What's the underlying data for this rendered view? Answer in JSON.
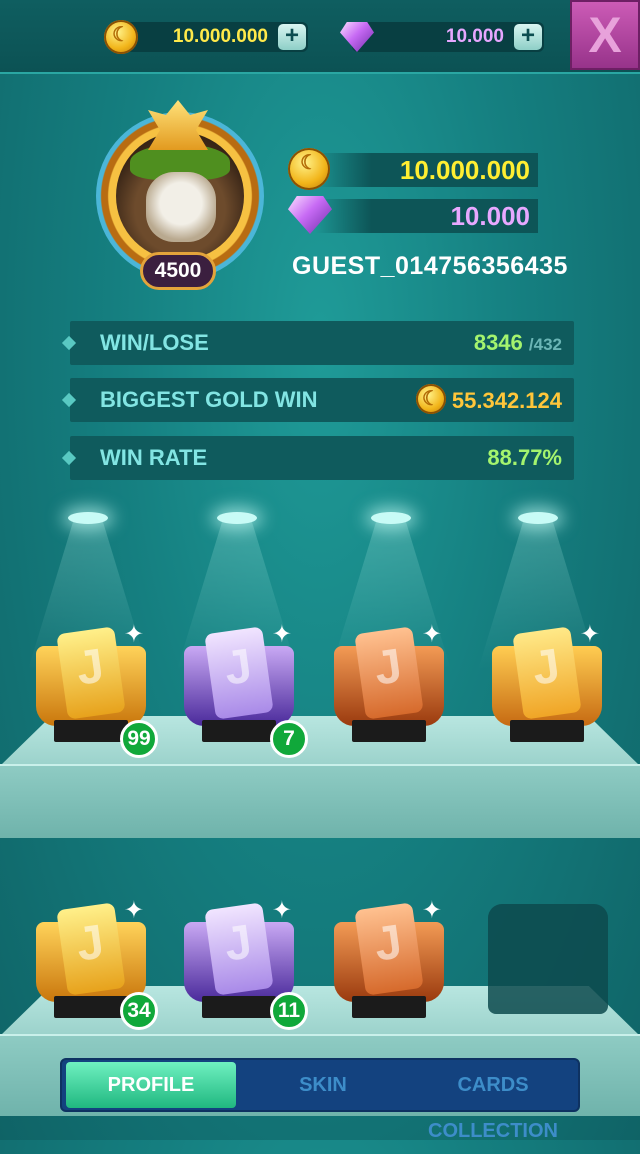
{
  "topbar": {
    "coin_icon": "gold-coin-icon",
    "coin_amount": "10.000.000",
    "gem_icon": "purple-gem-icon",
    "gem_amount": "10.000",
    "plus_label": "+",
    "close_label": "X"
  },
  "profile": {
    "level": "4500",
    "gold": "10.000.000",
    "gems": "10.000",
    "username": "GUEST_014756356435"
  },
  "stats": {
    "win_lose_label": "WIN/LOSE",
    "wins": "8346",
    "losses": "/432",
    "biggest_win_label": "BIGGEST GOLD WIN",
    "biggest_win_value": "55.342.124",
    "win_rate_label": "WIN RATE",
    "win_rate_value": "88.77%"
  },
  "trophies": {
    "row1": [
      {
        "style": "gold",
        "count": "99"
      },
      {
        "style": "purple",
        "count": "7"
      },
      {
        "style": "copper",
        "count": ""
      },
      {
        "style": "amber",
        "count": ""
      }
    ],
    "row2": [
      {
        "style": "gold",
        "count": "34"
      },
      {
        "style": "purple",
        "count": "11"
      },
      {
        "style": "copper",
        "count": ""
      },
      {
        "style": "locked",
        "count": ""
      }
    ]
  },
  "tabs": {
    "profile": "PROFILE",
    "skin": "SKIN",
    "cards_collection": "CARDS COLLECTION"
  }
}
